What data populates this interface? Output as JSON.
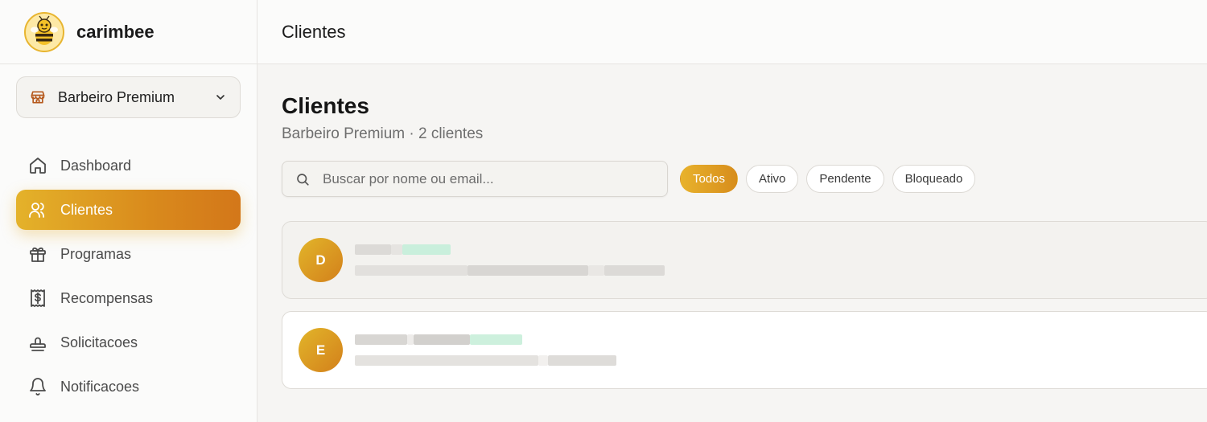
{
  "brand": {
    "name": "carimbee",
    "logo_icon": "bee-logo-icon"
  },
  "store_selector": {
    "label": "Barbeiro Premium",
    "icon": "store-icon"
  },
  "nav": {
    "items": [
      {
        "label": "Dashboard",
        "icon": "home-icon",
        "active": false
      },
      {
        "label": "Clientes",
        "icon": "users-icon",
        "active": true
      },
      {
        "label": "Programas",
        "icon": "gift-icon",
        "active": false
      },
      {
        "label": "Recompensas",
        "icon": "receipt-dollar-icon",
        "active": false
      },
      {
        "label": "Solicitacoes",
        "icon": "stamp-icon",
        "active": false
      },
      {
        "label": "Notificacoes",
        "icon": "bell-icon",
        "active": false
      }
    ]
  },
  "topbar": {
    "title": "Clientes"
  },
  "main": {
    "title": "Clientes",
    "subtitle": "Barbeiro Premium · 2 clientes",
    "search": {
      "placeholder": "Buscar por nome ou email..."
    },
    "filters": [
      {
        "label": "Todos",
        "active": true
      },
      {
        "label": "Ativo",
        "active": false
      },
      {
        "label": "Pendente",
        "active": false
      },
      {
        "label": "Bloqueado",
        "active": false
      }
    ],
    "clients": [
      {
        "initial": "D",
        "name_redacted": true,
        "email_redacted": true
      },
      {
        "initial": "E",
        "name_redacted": true,
        "email_redacted": true
      }
    ]
  },
  "colors": {
    "accent_start": "#e4b22a",
    "accent_end": "#d3771a",
    "background": "#f6f5f3",
    "sidebar": "#fbfbfa"
  }
}
